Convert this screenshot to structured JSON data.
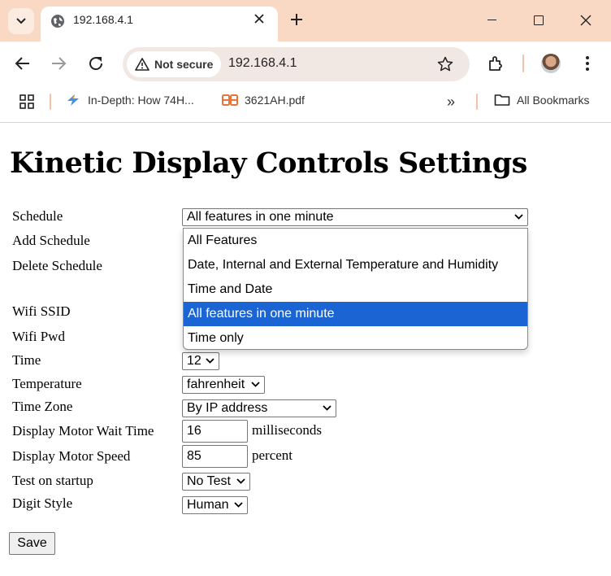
{
  "browser": {
    "tab_title": "192.168.4.1",
    "security_label": "Not secure",
    "url": "192.168.4.1",
    "bookmarks": [
      {
        "label": "In-Depth: How 74H...",
        "icon": "lightning-icon"
      },
      {
        "label": "3621AH.pdf",
        "icon": "pdf-icon"
      }
    ],
    "all_bookmarks_label": "All Bookmarks",
    "more_bookmarks_glyph": "»"
  },
  "page": {
    "title": "Kinetic Display Controls Settings",
    "labels": {
      "schedule": "Schedule",
      "add_schedule": "Add Schedule",
      "delete_schedule": "Delete Schedule",
      "wifi_ssid": "Wifi SSID",
      "wifi_pwd": "Wifi Pwd",
      "time": "Time",
      "temperature": "Temperature",
      "time_zone": "Time Zone",
      "motor_wait": "Display Motor Wait Time",
      "motor_speed": "Display Motor Speed",
      "test_startup": "Test on startup",
      "digit_style": "Digit Style"
    },
    "values": {
      "schedule": "All features in one minute",
      "time": "12",
      "temperature": "fahrenheit",
      "time_zone": "By IP address",
      "motor_wait": "16",
      "motor_speed": "85",
      "test_startup": "No Test",
      "digit_style": "Human"
    },
    "units": {
      "motor_wait": "milliseconds",
      "motor_speed": "percent"
    },
    "schedule_options": [
      "All Features",
      "Date, Internal and External Temperature and Humidity",
      "Time and Date",
      "All features in one minute",
      "Time only"
    ],
    "selected_option": "All features in one minute",
    "save_label": "Save"
  },
  "colors": {
    "tabstrip": "#f9d8c4",
    "selected_option": "#1a65d3"
  }
}
